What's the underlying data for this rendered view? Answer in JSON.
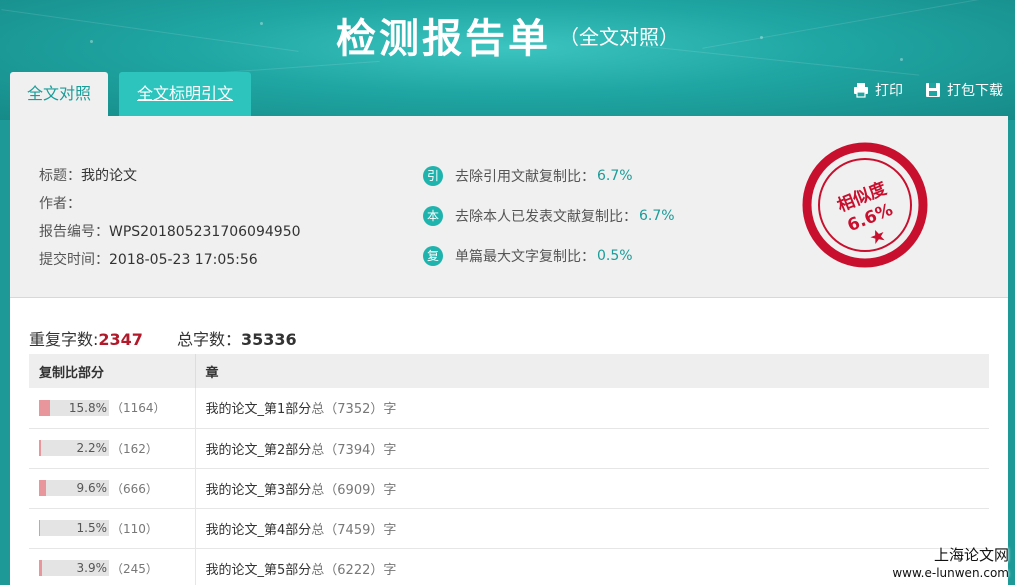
{
  "header": {
    "title": "检测报告单",
    "subtitle": "（全文对照）"
  },
  "tabs": [
    {
      "label": "全文对照",
      "active": true
    },
    {
      "label": "全文标明引文",
      "active": false
    }
  ],
  "toolbar": {
    "print_label": "打印",
    "download_label": "打包下载"
  },
  "meta": {
    "title_label": "标题：",
    "title_value": "我的论文",
    "author_label": "作者：",
    "author_value": "",
    "report_no_label": "报告编号：",
    "report_no_value": "WPS201805231706094950",
    "submit_time_label": "提交时间：",
    "submit_time_value": "2018-05-23 17:05:56"
  },
  "stats": [
    {
      "icon": "引",
      "label": "去除引用文献复制比：",
      "value": "6.7%"
    },
    {
      "icon": "本",
      "label": "去除本人已发表文献复制比：",
      "value": "6.7%"
    },
    {
      "icon": "复",
      "label": "单篇最大文字复制比：",
      "value": "0.5%"
    }
  ],
  "stamp": {
    "label": "相似度",
    "value": "6.6%",
    "color": "#c8102e"
  },
  "counts": {
    "dup_label": "重复字数:",
    "dup_value": "2347",
    "total_label": "总字数：",
    "total_value": "35336"
  },
  "table": {
    "headers": [
      "复制比部分",
      "章"
    ],
    "rows": [
      {
        "pct": "15.8%",
        "pct_value": 15.8,
        "count": "（1164）",
        "chapter": "我的论文_第1部分",
        "total": "总（7352）字"
      },
      {
        "pct": "2.2%",
        "pct_value": 2.2,
        "count": "（162）",
        "chapter": "我的论文_第2部分",
        "total": "总（7394）字"
      },
      {
        "pct": "9.6%",
        "pct_value": 9.6,
        "count": "（666）",
        "chapter": "我的论文_第3部分",
        "total": "总（6909）字"
      },
      {
        "pct": "1.5%",
        "pct_value": 1.5,
        "count": "（110）",
        "chapter": "我的论文_第4部分",
        "total": "总（7459）字"
      },
      {
        "pct": "3.9%",
        "pct_value": 3.9,
        "count": "（245）",
        "chapter": "我的论文_第5部分",
        "total": "总（6222）字"
      }
    ]
  },
  "watermark": {
    "name": "上海论文网",
    "url": "www.e-lunwen.com"
  },
  "colors": {
    "brand_teal": "#1fa6a3",
    "accent_red": "#b01a2a",
    "bar_fill": "#e8959b"
  }
}
